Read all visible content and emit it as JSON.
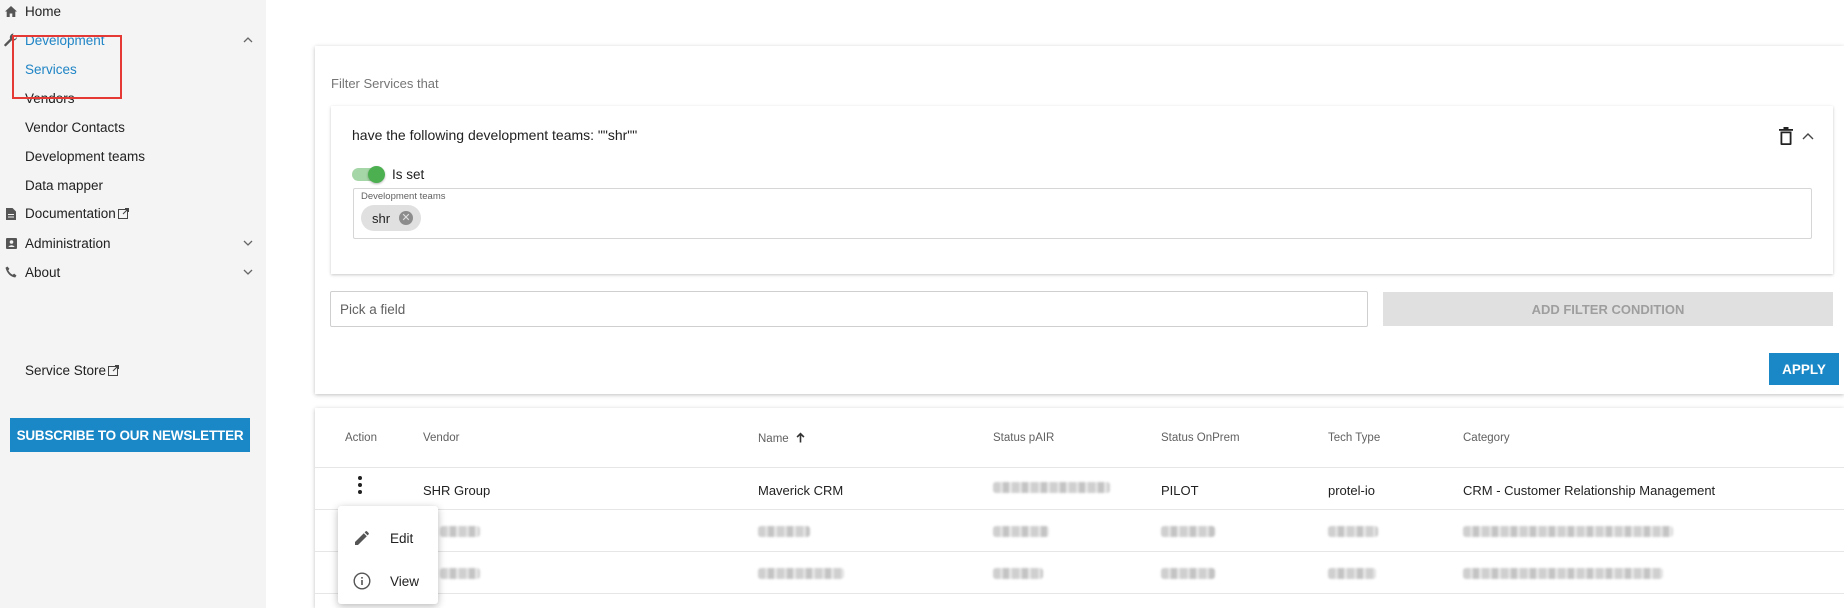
{
  "sidebar": {
    "items": [
      {
        "label": "Home",
        "icon": "home-icon"
      },
      {
        "label": "Development",
        "icon": "wrench-icon",
        "expanded": true
      },
      {
        "label": "Services",
        "active": true
      },
      {
        "label": "Vendors"
      },
      {
        "label": "Vendor Contacts"
      },
      {
        "label": "Development teams"
      },
      {
        "label": "Data mapper"
      },
      {
        "label": "Documentation",
        "icon": "document-icon",
        "external": true
      },
      {
        "label": "Administration",
        "icon": "admin-badge-icon"
      },
      {
        "label": "About",
        "icon": "phone-icon"
      },
      {
        "label": "Service Store",
        "external": true
      }
    ],
    "subscribe_label": "SUBSCRIBE TO OUR NEWSLETTER"
  },
  "filter": {
    "title": "Filter Services that",
    "condition_text": "have the following development teams: \"\"shr\"\"",
    "toggle_label": "Is set",
    "toggle_on": true,
    "teams_label": "Development teams",
    "chips": [
      "shr"
    ],
    "pick_placeholder": "Pick a field",
    "add_label": "ADD FILTER CONDITION",
    "apply_label": "APPLY"
  },
  "table": {
    "headers": [
      "Action",
      "Vendor",
      "Name",
      "Status pAIR",
      "Status OnPrem",
      "Tech Type",
      "Category"
    ],
    "sort_column": "Name",
    "rows": [
      {
        "vendor": "SHR Group",
        "name": "Maverick CRM",
        "status_pair": "",
        "status_onprem": "PILOT",
        "tech_type": "protel-io",
        "category": "CRM - Customer Relationship Management"
      },
      {
        "vendor": "R",
        "name": "",
        "status_pair": "",
        "status_onprem": "",
        "tech_type": "",
        "category": ""
      },
      {
        "vendor": "R",
        "name": "",
        "status_pair": "",
        "status_onprem": "",
        "tech_type": "",
        "category": ""
      }
    ]
  },
  "row_menu": {
    "items": [
      {
        "label": "Edit",
        "icon": "pencil-icon"
      },
      {
        "label": "View",
        "icon": "info-icon"
      }
    ]
  },
  "colors": {
    "accent": "#1a87c6",
    "active_link": "#1f84c5",
    "highlight": "#e53935",
    "toggle_on": "#4caf50"
  }
}
